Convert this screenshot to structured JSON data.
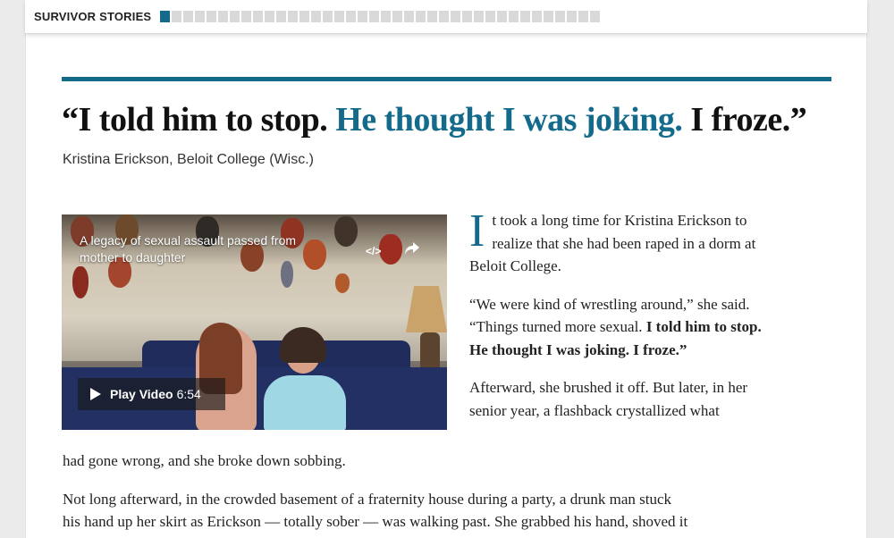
{
  "topbar": {
    "label": "SURVIVOR STORIES",
    "segments_total": 38,
    "active_index": 0,
    "accent": "#136a8a"
  },
  "article": {
    "headline_part1": "“I told him to stop.",
    "headline_highlight": "He thought I was joking.",
    "headline_part2": "I froze.”",
    "byline": "Kristina Erickson, Beloit College (Wisc.)",
    "video": {
      "title": "A legacy of sexual assault passed from mother to daughter",
      "embed_icon": "</>",
      "play_label": "Play Video",
      "duration": "6:54"
    },
    "dropcap": "I",
    "p1": "t took a long time for Kristina Erickson to realize that she had been raped in a dorm at Beloit College.",
    "p2_pre": "“We were kind of wrestling around,” she said. “Things turned more sexual. ",
    "p2_bold": "I told him to stop. He thought I was joking. I froze.”",
    "p3_col": "Afterward, she brushed it off. But later, in her senior year, a flashback crystallized what",
    "p3_full": "had gone wrong, and she broke down sobbing.",
    "p4_line1": "Not long afterward, in the crowded basement of a fraternity house during a party, a drunk man stuck",
    "p4_line2": "his hand up her skirt as Erickson — totally sober — was walking past. She grabbed his hand, shoved it"
  }
}
